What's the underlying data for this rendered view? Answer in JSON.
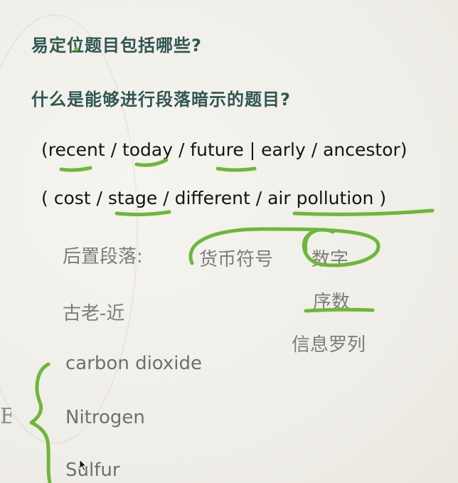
{
  "questions": {
    "q1": "易定位题目包括哪些?",
    "q2": "什么是能够进行段落暗示的题目?"
  },
  "keywords": {
    "line1": "(recent / today / future | early / ancestor)",
    "line2": "( cost / stage / different / air pollution )"
  },
  "notes": {
    "post_paragraph_label": "后置段落:",
    "currency_symbol": "货币符号",
    "digits": "数字",
    "ordinal": "序数",
    "ancient_near": "古老-近",
    "info_list": "信息罗列"
  },
  "items": [
    "carbon dioxide",
    "Nitrogen",
    "Sulfur"
  ],
  "edge_glyph": "E",
  "colors": {
    "heading": "#2f5650",
    "keyword": "#141414",
    "note": "#7c7c7c",
    "annotation": "#6cb83a",
    "background": "#f3f1ec"
  }
}
